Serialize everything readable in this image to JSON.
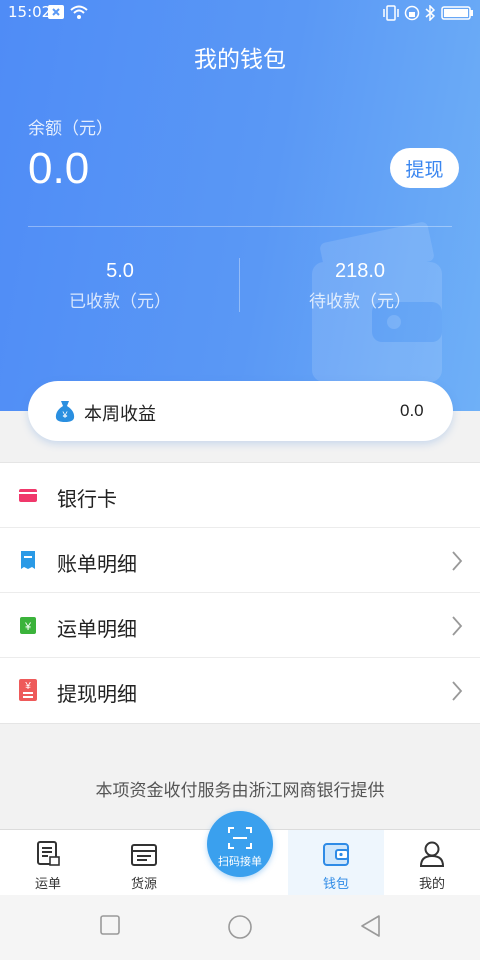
{
  "status_bar": {
    "time": "15:02"
  },
  "header": {
    "title": "我的钱包"
  },
  "balance": {
    "label": "余额（元）",
    "value": "0.0",
    "withdraw_label": "提现"
  },
  "stats": {
    "received": {
      "value": "5.0",
      "label": "已收款（元）"
    },
    "pending": {
      "value": "218.0",
      "label": "待收款（元）"
    }
  },
  "weekly": {
    "label": "本周收益",
    "value": "0.0"
  },
  "menu": {
    "items": [
      {
        "label": "银行卡",
        "icon": "bank-card-icon",
        "color": "#f0386b",
        "has_arrow": false
      },
      {
        "label": "账单明细",
        "icon": "bill-icon",
        "color": "#2a9ae6",
        "has_arrow": true
      },
      {
        "label": "运单明细",
        "icon": "waybill-icon",
        "color": "#3bb33b",
        "has_arrow": true
      },
      {
        "label": "提现明细",
        "icon": "withdraw-record-icon",
        "color": "#ee5a5a",
        "has_arrow": true
      }
    ]
  },
  "footer": {
    "note": "本项资金收付服务由浙江网商银行提供"
  },
  "tabbar": {
    "tabs": [
      {
        "label": "运单",
        "icon": "waybill-tab-icon"
      },
      {
        "label": "货源",
        "icon": "cargo-source-icon"
      },
      {
        "label": "钱包",
        "icon": "wallet-icon",
        "active": true
      },
      {
        "label": "我的",
        "icon": "profile-icon"
      }
    ],
    "scan_label": "扫码接单"
  },
  "colors": {
    "accent": "#3a86f0",
    "hero_start": "#4f8cf6",
    "hero_end": "#6fb0f7",
    "tab_active": "#2f8be6"
  }
}
